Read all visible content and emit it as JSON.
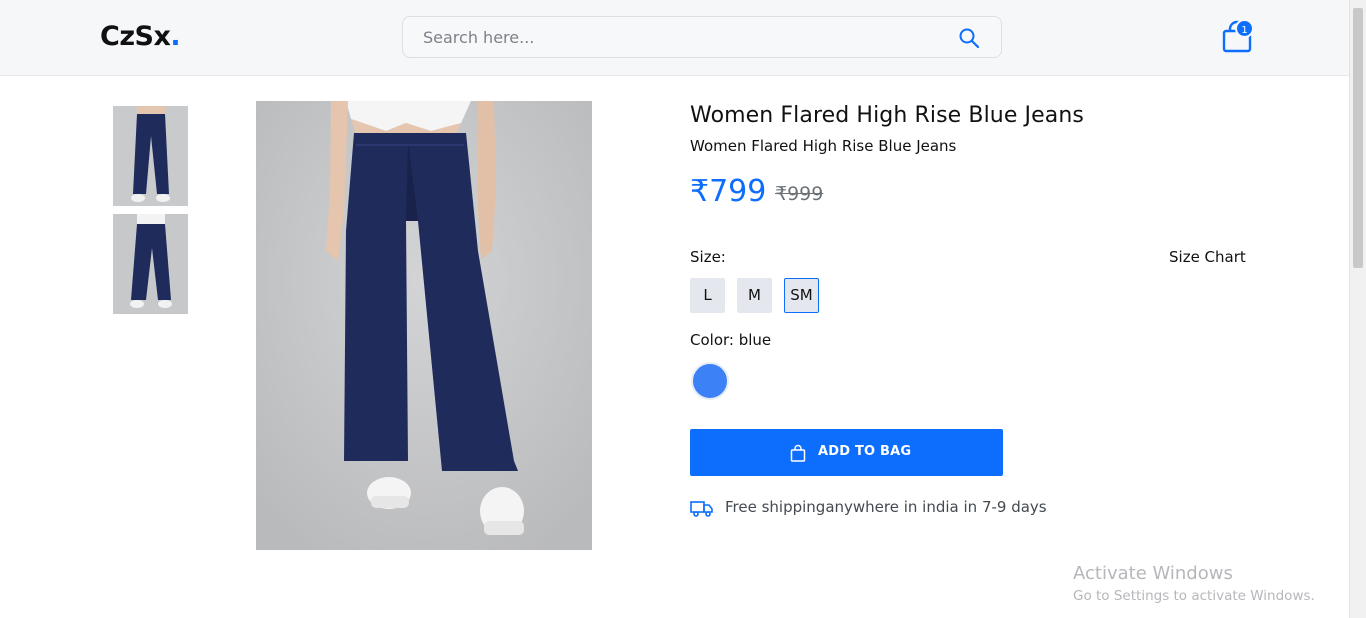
{
  "header": {
    "logo_text": "CzSx",
    "logo_dot": ".",
    "search_placeholder": "Search here...",
    "cart_count": "1"
  },
  "product": {
    "title": "Women Flared High Rise Blue Jeans",
    "subtitle": "Women Flared High Rise Blue Jeans",
    "price": "₹799",
    "mrp": "₹999",
    "size_label": "Size:",
    "size_chart_label": "Size Chart",
    "sizes": [
      "L",
      "M",
      "SM"
    ],
    "selected_size": "SM",
    "color_label": "Color: blue",
    "color_swatch": "#3c82f6",
    "add_to_bag_label": "ADD TO BAG",
    "shipping_text": "Free shippinganywhere in india in 7-9 days"
  },
  "watermark": {
    "title": "Activate Windows",
    "subtitle": "Go to Settings to activate Windows."
  },
  "colors": {
    "accent": "#0d6efd",
    "header_bg": "#f6f7f9",
    "denim": "#1f2b5a"
  }
}
